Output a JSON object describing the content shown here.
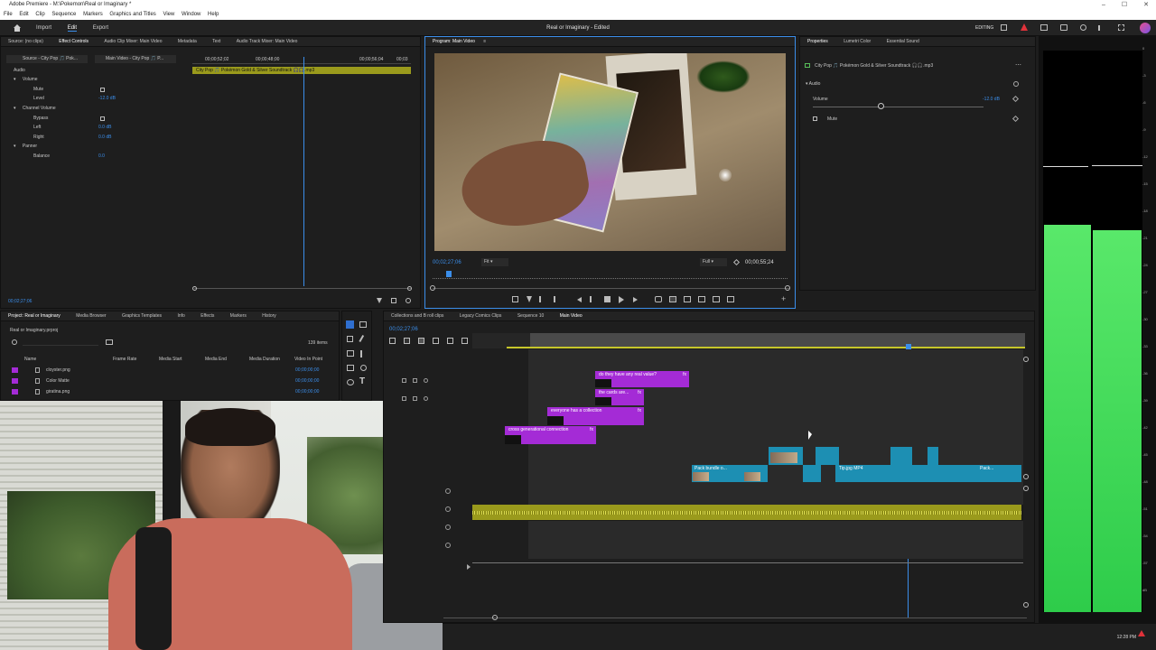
{
  "window": {
    "title": "Adobe Premiere - M:\\Pokemon\\Real or Imaginary *",
    "controls": [
      "–",
      "☐",
      "✕"
    ]
  },
  "menu": [
    "File",
    "Edit",
    "Clip",
    "Sequence",
    "Markers",
    "Graphics and Titles",
    "View",
    "Window",
    "Help"
  ],
  "header": {
    "nav": [
      "Import",
      "Edit",
      "Export"
    ],
    "active": "Edit",
    "project_title": "Real or Imaginary - Edited",
    "workspace": "EDITING"
  },
  "source_panel": {
    "tabs": [
      "Source: (no clips)",
      "Effect Controls",
      "Audio Clip Mixer: Main Video",
      "Metadata",
      "Text",
      "Audio Track Mixer: Main Video"
    ],
    "active_tab": "Effect Controls",
    "source_sel": "Source - City Pop 🎵 Pok...",
    "seq_sel": "Main Video - City Pop 🎵 P...",
    "ruler": [
      "00;00;52;02",
      "00;00;48;00",
      "00;00;56;04",
      "00;03"
    ],
    "clip_label": "City Pop 🎵 Pokémon Gold & Silver Soundtrack 🎧🎧.mp3",
    "section": "Audio",
    "rows": [
      {
        "name": "Volume",
        "value": ""
      },
      {
        "name": "Mute",
        "value": ""
      },
      {
        "name": "Level",
        "value": "-12.0 dB"
      },
      {
        "name": "Channel Volume",
        "value": ""
      },
      {
        "name": "Bypass",
        "value": ""
      },
      {
        "name": "Left",
        "value": "0.0 dB"
      },
      {
        "name": "Right",
        "value": "0.0 dB"
      },
      {
        "name": "Panner",
        "value": ""
      },
      {
        "name": "Balance",
        "value": "0.0"
      }
    ],
    "timecode": "00;02;27;06"
  },
  "program": {
    "title": "Program: Main Video",
    "timecode": "00;02;27;06",
    "fit": "Fit",
    "quality": "Full",
    "duration": "00;00;55;24"
  },
  "properties": {
    "tabs": [
      "Properties",
      "Lumetri Color",
      "Essential Sound"
    ],
    "clip": "City Pop 🎵 Pokémon Gold & Silver Soundtrack 🎧🎧.mp3",
    "section": "Audio",
    "volume_label": "Volume",
    "volume_value": "-12.0 dB",
    "mute_label": "Mute"
  },
  "project": {
    "tabs": [
      "Project: Real or Imaginary",
      "Media Browser",
      "Graphics Templates",
      "Info",
      "Effects",
      "Markers",
      "History"
    ],
    "file": "Real or Imaginary.prproj",
    "count": "139 items",
    "columns": [
      "Name",
      "Frame Rate",
      "Media Start",
      "Media End",
      "Media Duration",
      "Video In Point"
    ],
    "rows": [
      {
        "name": "cloyster.png",
        "in": "00;00;00;00"
      },
      {
        "name": "Color Matte",
        "in": "00;00;00;00"
      },
      {
        "name": "giratina.png",
        "in": "00;00;00;00"
      }
    ]
  },
  "timeline": {
    "tabs": [
      "Collections and B roll clips",
      "Legacy Comics Clips",
      "Sequence 10",
      "Main Video"
    ],
    "active_tab": "Main Video",
    "timecode": "00;02;27;06",
    "clips": [
      {
        "label": "do they have any real value?",
        "fx": "fx"
      },
      {
        "label": "the cards are...",
        "fx": "fx"
      },
      {
        "label": "everyone has a collection",
        "fx": "fx"
      },
      {
        "label": "cross generational connection",
        "fx": "fx"
      },
      {
        "label": "Pack bundle o...",
        "fx": ""
      },
      {
        "label": "Tip.jpg MP4",
        "fx": ""
      },
      {
        "label": "Pack...",
        "fx": ""
      }
    ]
  },
  "meters": {
    "scale": [
      "0",
      "-3",
      "-6",
      "-9",
      "-12",
      "-15",
      "-18",
      "-21",
      "-24",
      "-27",
      "-30",
      "-33",
      "-36",
      "-39",
      "-42",
      "-45",
      "-48",
      "-51",
      "-54",
      "-57",
      "dB"
    ],
    "left_level": 0.69,
    "right_level": 0.68
  },
  "taskbar": {
    "time": "12:28 PM"
  },
  "colors": {
    "accent": "#3b8eea",
    "caption_clip": "#a42bd6",
    "video_clip": "#1d8fb3",
    "audio_clip": "#9a9a1c",
    "meter": "#4fd65f"
  }
}
